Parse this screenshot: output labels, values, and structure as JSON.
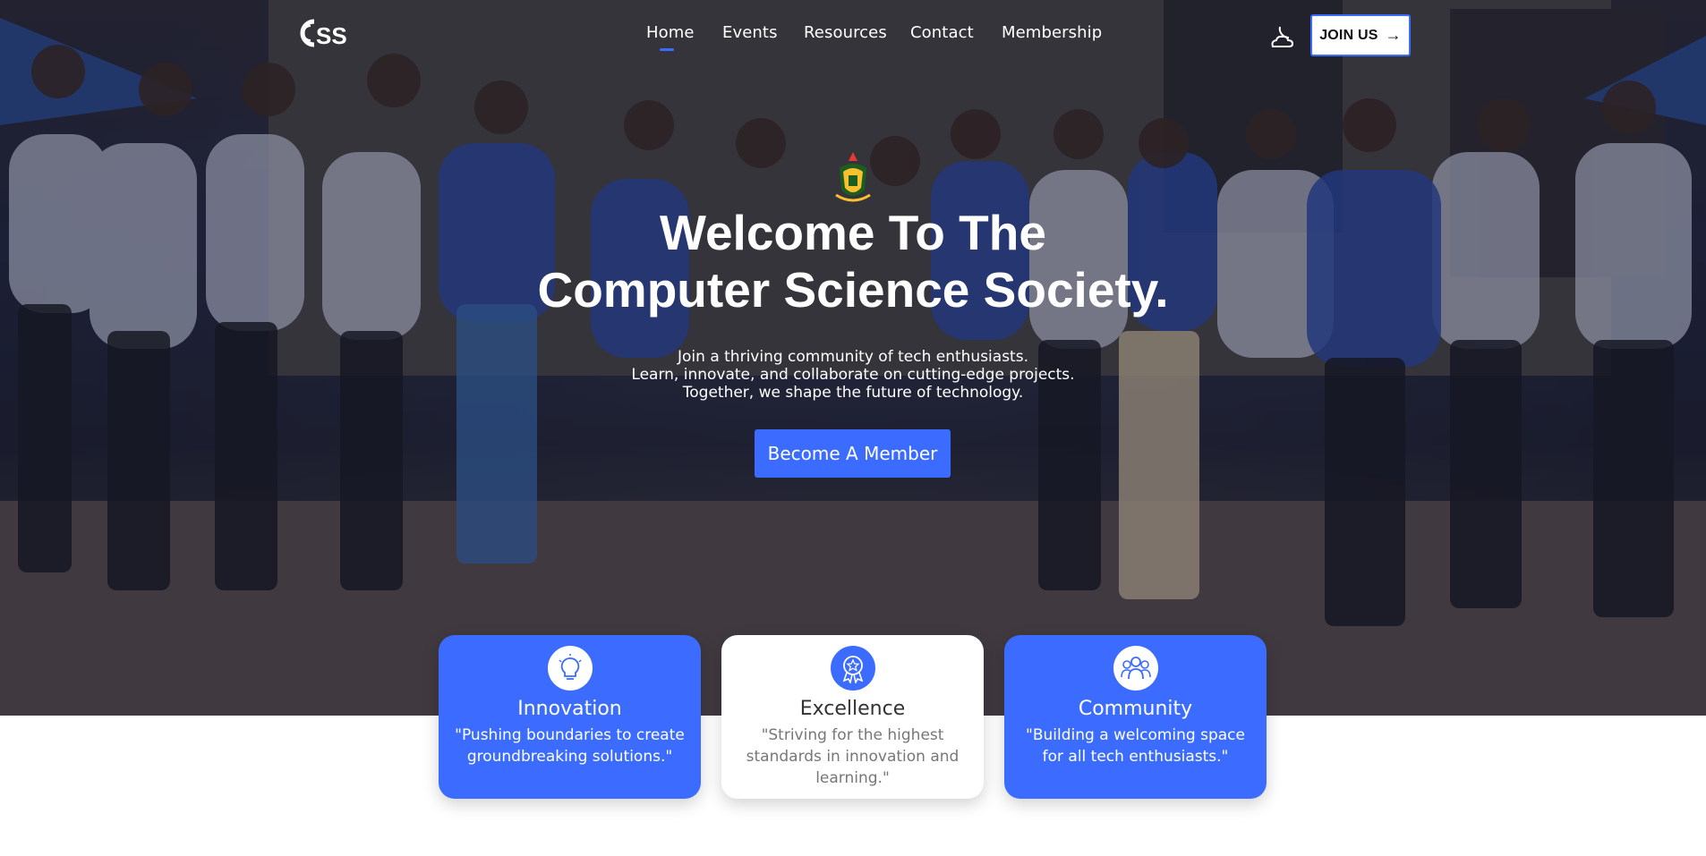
{
  "nav": {
    "logo_text": "CSS",
    "links": [
      "Home",
      "Events",
      "Resources",
      "Contact",
      "Membership"
    ],
    "active": "Home",
    "theme_icon": "moon-cloud-icon",
    "join_label": "JOIN US",
    "join_icon": "arrow-right-icon"
  },
  "hero": {
    "title_line1": "Welcome To The",
    "title_line2": "Computer Science Society.",
    "subtitle_line1": "Join a thriving community of tech enthusiasts.",
    "subtitle_line2": "Learn, innovate, and collaborate on cutting-edge projects.",
    "subtitle_line3": "Together, we shape the future of technology.",
    "cta_label": "Become A Member",
    "emblem_icon": "university-crest-icon"
  },
  "cards": [
    {
      "title": "Innovation",
      "text": "\"Pushing boundaries to create groundbreaking solutions.\"",
      "icon": "lightbulb-icon"
    },
    {
      "title": "Excellence",
      "text": "\"Striving for the highest standards in innovation and learning.\"",
      "icon": "award-badge-icon"
    },
    {
      "title": "Community",
      "text": "\"Building a welcoming space for all tech enthusiasts.\"",
      "icon": "people-group-icon"
    }
  ],
  "colors": {
    "accent": "#3b6cff",
    "hero_overlay": "#1e2240",
    "card_white": "#ffffff"
  }
}
